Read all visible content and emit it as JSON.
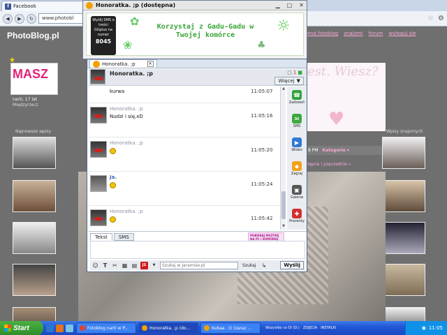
{
  "browser": {
    "tab_title": "Facebook",
    "address": "www.photobl"
  },
  "site": {
    "logo": "PhotoBlog.pl",
    "nav": [
      "moj fotoblog",
      "znajomi",
      "forum",
      "wyloguj sie"
    ],
    "banner_left": "MASZ",
    "user_name": "narti, 17 lat",
    "user_city": "Międzyrzecz",
    "banner_right": "est. Wiesz?",
    "sidebar_left_title": "Najnowsze wpisy",
    "sidebar_right_title": "Wpisy znajomych",
    "pinkbar_time": "8 PM",
    "pinkbar_category": "Kategorie ▾",
    "pager": "stępne | poprzednie »"
  },
  "ad_window": {
    "title": "Honoratka. ;p (dostępna)",
    "slogan": "Korzystaj z Gadu-Gadu w Twojej komórce",
    "phone_text": "Wyślij SMS o treści GGplus na numer",
    "phone_number": "8045"
  },
  "chat": {
    "tab_label": "Honoratka. ;p",
    "contact_name": "Honoratka. ;p",
    "more_label": "Więcej",
    "header_count": "1",
    "messages": [
      {
        "author": "",
        "text": "kurwa",
        "time": "11:05:07"
      },
      {
        "author": "Honoratka. ;p",
        "text": "Nudzi i się,xD",
        "time": "11:05:16"
      },
      {
        "author": "Honoratka. ;p",
        "text": "",
        "time": "11:05:20"
      },
      {
        "author": "Ja.",
        "text": "",
        "time": "11:05:24"
      },
      {
        "author": "Honoratka. ;p",
        "text": "",
        "time": "11:05:42"
      }
    ],
    "actions": [
      {
        "label": "Zadzwoń",
        "color": "#2fa33a",
        "glyph": "☎"
      },
      {
        "label": "SMS",
        "color": "#3da83d",
        "glyph": "✉"
      },
      {
        "label": "Wideo",
        "color": "#2f7ad3",
        "glyph": "▶"
      },
      {
        "label": "Zagraj",
        "color": "#f2a11a",
        "glyph": "◆"
      },
      {
        "label": "Galeria",
        "color": "#555555",
        "glyph": "▣"
      },
      {
        "label": "Prezenty",
        "color": "#d23131",
        "glyph": "✚"
      }
    ],
    "compose_tabs": [
      "Tekst",
      "SMS"
    ],
    "promo_text": "POBIERAJ MUZYKĘ NA PC I KOMÓRKĘ",
    "search_placeholder": "Szukaj w Jaramsie.pl",
    "search_label": "Szukaj",
    "send_label": "Wyślij"
  },
  "taskbar": {
    "start": "Start",
    "tasks": [
      {
        "label": "Fotoblog narti w P...",
        "color": "#e6412b"
      },
      {
        "label": "Honoratka. ;p (do...",
        "color": "#f1a000"
      },
      {
        "label": "Kubaa. :)) (zaraz ...",
        "color": "#f1a000"
      }
    ],
    "tray_items": [
      "Wszystko co Ol (D:)",
      "ZDJĘCIA",
      "INSTALKI"
    ],
    "clock": "11:05"
  }
}
